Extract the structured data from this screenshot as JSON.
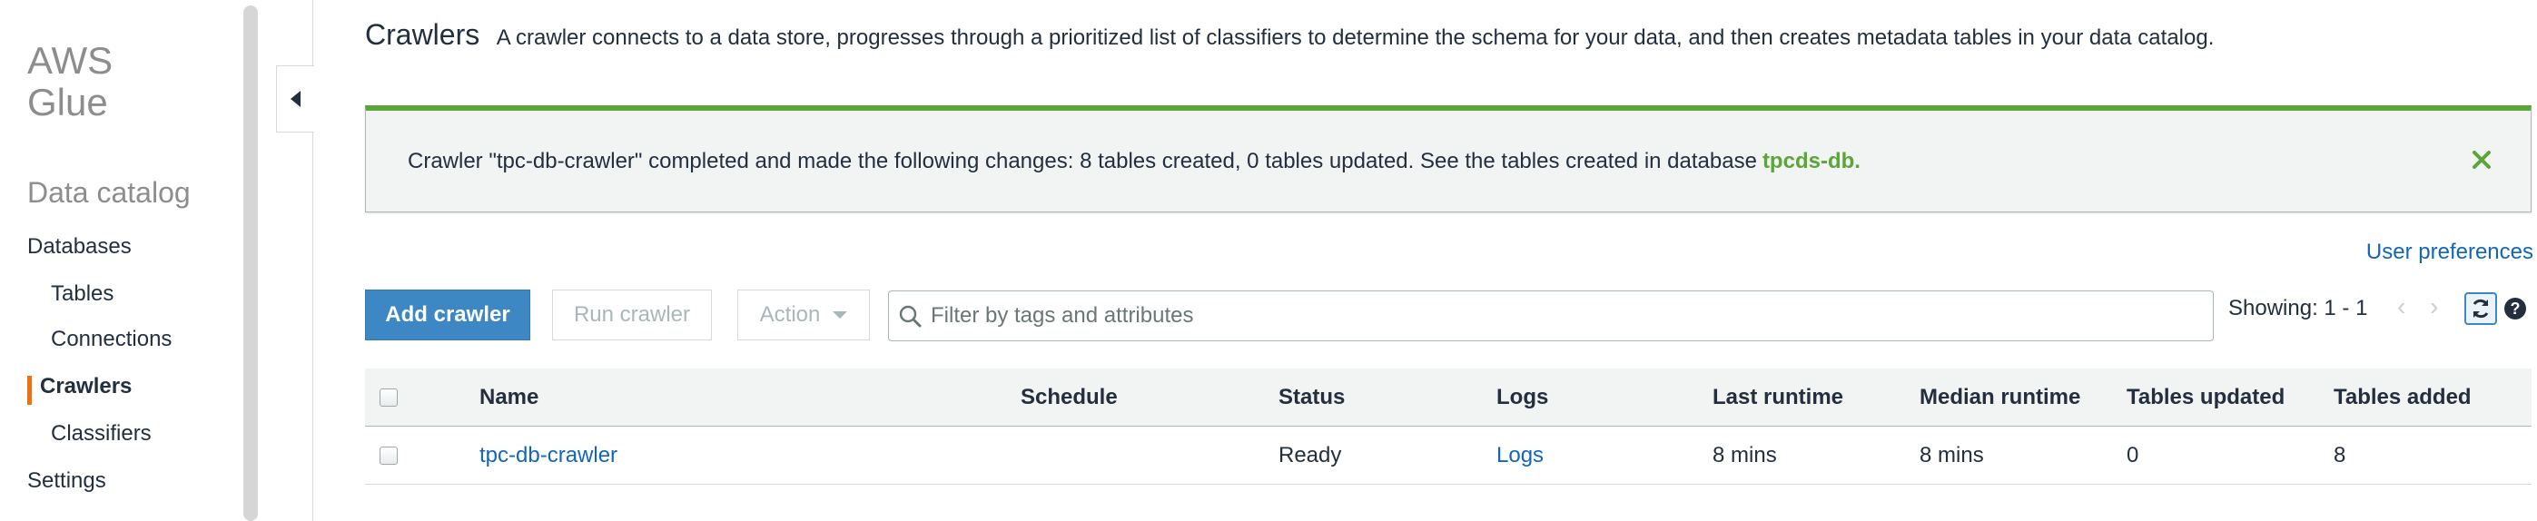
{
  "sidebar": {
    "brand_line1": "AWS",
    "brand_line2": "Glue",
    "section_title": "Data catalog",
    "items": [
      {
        "label": "Databases"
      },
      {
        "label": "Tables"
      },
      {
        "label": "Connections"
      },
      {
        "label": "Crawlers"
      },
      {
        "label": "Classifiers"
      },
      {
        "label": "Settings"
      }
    ],
    "active_item": "Crawlers",
    "active_color": "#ec7211"
  },
  "header": {
    "title": "Crawlers",
    "description": "A crawler connects to a data store, progresses through a prioritized list of classifiers to determine the schema for your data, and then creates metadata tables in your data catalog."
  },
  "alert": {
    "message": "Crawler \"tpc-db-crawler\" completed and made the following changes: 8 tables created, 0 tables updated. See the tables created in database",
    "link": "tpcds-db.",
    "accent_color": "#5aa637"
  },
  "toolbar": {
    "user_preferences": "User preferences",
    "add_crawler": "Add crawler",
    "run_crawler": "Run crawler",
    "action": "Action",
    "search_placeholder": "Filter by tags and attributes",
    "showing": "Showing: 1 - 1",
    "prev_arrow": "‹",
    "next_arrow": "›",
    "help": "?"
  },
  "table": {
    "columns": [
      "Name",
      "Schedule",
      "Status",
      "Logs",
      "Last runtime",
      "Median runtime",
      "Tables updated",
      "Tables added"
    ],
    "rows": [
      {
        "name": "tpc-db-crawler",
        "schedule": "",
        "status": "Ready",
        "logs": "Logs",
        "last_runtime": "8 mins",
        "median_runtime": "8 mins",
        "tables_updated": "0",
        "tables_added": "8"
      }
    ]
  },
  "colors": {
    "primary": "#3d87c5",
    "link": "#1166bb",
    "text": "#232f3e"
  }
}
